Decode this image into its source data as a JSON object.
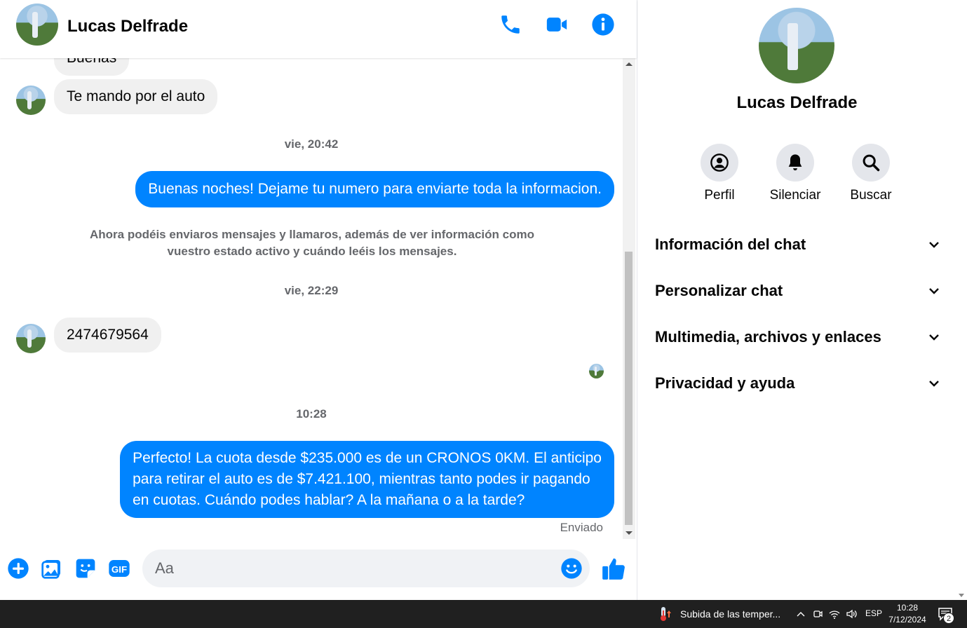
{
  "contact": {
    "name": "Lucas Delfrade"
  },
  "header_icons": [
    "phone-icon",
    "video-icon",
    "info-icon"
  ],
  "messages": {
    "partial_top": "Buenas",
    "in_1": "Te mando por el auto",
    "ts_1": "vie, 20:42",
    "out_1": "Buenas noches! Dejame tu numero para enviarte toda la informacion.",
    "system_notice": "Ahora podéis enviaros mensajes y llamaros, además de ver información como vuestro estado activo y cuándo leéis los mensajes.",
    "ts_2": "vie, 22:29",
    "in_2": "2474679564",
    "ts_3": "10:28",
    "out_2_lines": [
      "Perfecto! La cuota desde $235.000 es de un CRONOS 0KM. El anticipo",
      "para retirar el auto es de $7.421.100, mientras tanto podes ir pagando",
      "en cuotas. Cuándo podes hablar? A la mañana o a la tarde?"
    ],
    "status": "Enviado"
  },
  "composer": {
    "placeholder": "Aa"
  },
  "info_pane": {
    "name": "Lucas Delfrade",
    "actions": [
      {
        "label": "Perfil",
        "icon": "profile-icon"
      },
      {
        "label": "Silenciar",
        "icon": "bell-icon"
      },
      {
        "label": "Buscar",
        "icon": "search-icon"
      }
    ],
    "sections": [
      "Información del chat",
      "Personalizar chat",
      "Multimedia, archivos y enlaces",
      "Privacidad y ayuda"
    ]
  },
  "taskbar": {
    "weather_text": "Subida de las temper...",
    "language": "ESP",
    "time": "10:28",
    "date": "7/12/2024",
    "notification_count": "2"
  },
  "colors": {
    "accent": "#0084ff",
    "incoming_bubble": "#f0f0f0",
    "muted_text": "#65676b",
    "taskbar": "#202020"
  }
}
